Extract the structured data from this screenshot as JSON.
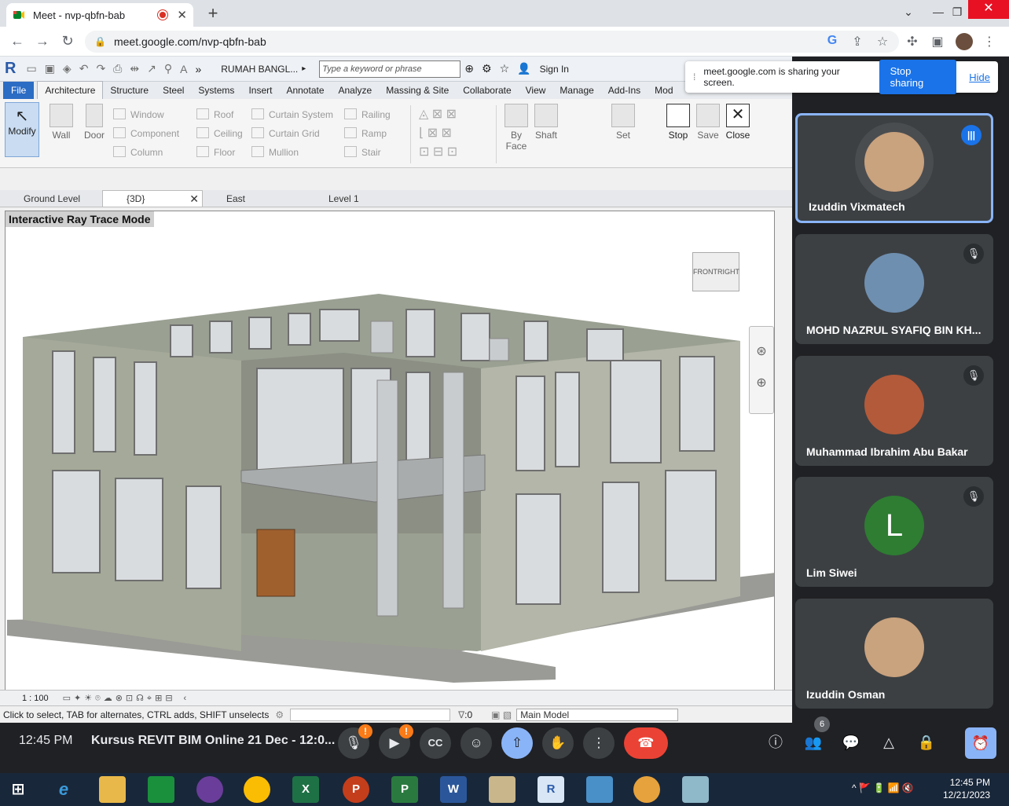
{
  "browser": {
    "tab_title": "Meet - nvp-qbfn-bab",
    "tab_close": "✕",
    "new_tab": "+",
    "url": "meet.google.com/nvp-qbfn-bab"
  },
  "revit": {
    "project": "RUMAH BANGL...",
    "search_placeholder": "Type a keyword or phrase",
    "sign_in": "Sign In",
    "menu_tabs": [
      "File",
      "Architecture",
      "Structure",
      "Steel",
      "Systems",
      "Insert",
      "Annotate",
      "Analyze",
      "Massing & Site",
      "Collaborate",
      "View",
      "Manage",
      "Add-Ins",
      "Mod"
    ],
    "ribbon": {
      "modify": "Modify",
      "wall": "Wall",
      "door": "Door",
      "col1": [
        "Window",
        "Component",
        "Column"
      ],
      "col2": [
        "Roof",
        "Ceiling",
        "Floor"
      ],
      "col3": [
        "Curtain System",
        "Curtain Grid",
        "Mullion"
      ],
      "col4": [
        "Railing",
        "Ramp",
        "Stair"
      ],
      "by_face": "By Face",
      "shaft": "Shaft",
      "set": "Set",
      "stop": "Stop",
      "save": "Save",
      "close": "Close"
    },
    "view_tabs": [
      "Ground Level",
      "{3D}",
      "East",
      "Level 1"
    ],
    "viewport_label": "Interactive Ray Trace Mode",
    "viewcube_front": "FRONT",
    "viewcube_right": "RIGHT",
    "scale": "1 : 100",
    "status_text": "Click to select, TAB for alternates, CTRL adds, SHIFT unselects",
    "filter_count": ":0",
    "main_model": "Main Model"
  },
  "share_banner": {
    "text": "meet.google.com is sharing your screen.",
    "stop": "Stop sharing",
    "hide": "Hide"
  },
  "participants": [
    {
      "name": "Izuddin Vixmatech",
      "speaking": true,
      "avatar_color": "#c9a27e"
    },
    {
      "name": "MOHD NAZRUL SYAFIQ BIN KH...",
      "muted": true,
      "avatar_color": "#6f8fb0"
    },
    {
      "name": "Muhammad Ibrahim Abu Bakar",
      "muted": true,
      "avatar_color": "#b35a3a"
    },
    {
      "name": "Lim Siwei",
      "muted": true,
      "initial": "L",
      "avatar_color": "#2e7d32"
    },
    {
      "name": "Izuddin Osman",
      "muted": false,
      "avatar_color": "#c9a27e"
    }
  ],
  "meet": {
    "time": "12:45 PM",
    "title": "Kursus REVIT BIM Online 21 Dec - 12:0...",
    "warn": "!",
    "participant_count": "6"
  },
  "taskbar": {
    "apps": [
      "e",
      "X",
      "P",
      "P",
      "W",
      "R"
    ],
    "clock_time": "12:45 PM",
    "clock_date": "12/21/2023"
  },
  "colors": {
    "meet_bg": "#202124",
    "accent": "#1a73e8",
    "end_call": "#ea4335",
    "revit_file": "#2b6cc4"
  }
}
